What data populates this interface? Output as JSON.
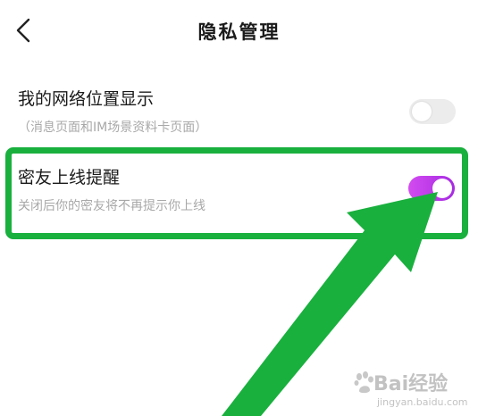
{
  "header": {
    "title": "隐私管理",
    "back_icon": "chevron-left-icon"
  },
  "settings": {
    "location_display": {
      "title": "我的网络位置显示",
      "description": "（消息页面和IM场景资料卡页面）",
      "enabled": false
    },
    "friend_online_reminder": {
      "title": "密友上线提醒",
      "description": "关闭后你的密友将不再提示你上线",
      "enabled": true
    }
  },
  "colors": {
    "toggle_on": "#c03ceb",
    "toggle_off": "#ececec",
    "highlight": "#19b03e",
    "arrow": "#19b03e"
  },
  "watermark": {
    "logo": "Bai经验",
    "url": "jingyan.baidu.com"
  }
}
